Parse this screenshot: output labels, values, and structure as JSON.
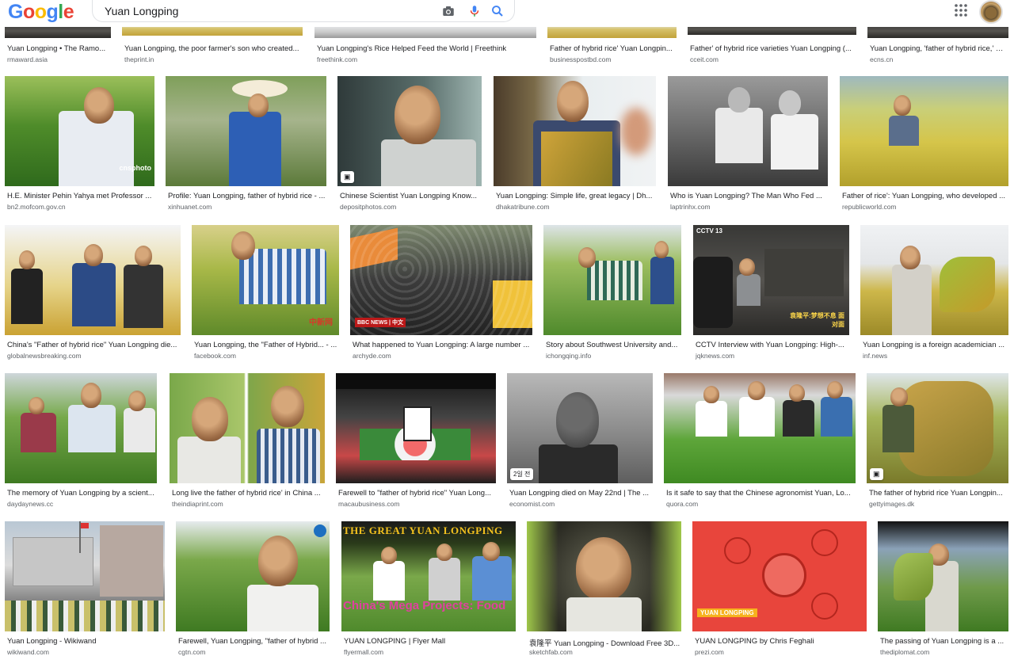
{
  "search": {
    "logo_letters": [
      "G",
      "o",
      "o",
      "g",
      "l",
      "e"
    ],
    "logo_colors": [
      "#4285F4",
      "#EA4335",
      "#FBBC05",
      "#4285F4",
      "#34A853",
      "#EA4335"
    ],
    "query": "Yuan Longping"
  },
  "colors": {
    "link_blue": "#4285F4",
    "text": "#202124",
    "source": "#5f6368"
  },
  "icons": [
    "camera-icon",
    "microphone-icon",
    "search-icon",
    "apps-grid-icon"
  ],
  "rows": [
    {
      "tiles": [
        {
          "title": "Yuan Longping • The Ramo...",
          "source": "rmaward.asia"
        },
        {
          "title": "Yuan Longping, the poor farmer's son who created...",
          "source": "theprint.in"
        },
        {
          "title": "Yuan Longping's Rice Helped Feed the World | Freethink",
          "source": "freethink.com"
        },
        {
          "title": "Father of hybrid rice' Yuan Longpin...",
          "source": "businesspostbd.com"
        },
        {
          "title": "Father' of hybrid rice varieties Yuan Longping (...",
          "source": "cceit.com"
        },
        {
          "title": "Yuan Longping, 'father of hybrid rice,' a...",
          "source": "ecns.cn"
        }
      ]
    },
    {
      "tiles": [
        {
          "title": "H.E. Minister Pehin Yahya met Professor ...",
          "source": "bn2.mofcom.gov.cn",
          "overlay": "cnsphoto"
        },
        {
          "title": "Profile: Yuan Longping, father of hybrid rice - ...",
          "source": "xinhuanet.com"
        },
        {
          "title": "Chinese Scientist Yuan Longping Know...",
          "source": "depositphotos.com"
        },
        {
          "title": "Yuan Longping: Simple life, great legacy | Dh...",
          "source": "dhakatribune.com"
        },
        {
          "title": "Who is Yuan Longping? The Man Who Fed ...",
          "source": "laptrinhx.com"
        },
        {
          "title": "Father of rice': Yuan Longping, who developed ...",
          "source": "republicworld.com"
        }
      ]
    },
    {
      "tiles": [
        {
          "title": "China's \"Father of hybrid rice\" Yuan Longping die...",
          "source": "globalnewsbreaking.com"
        },
        {
          "title": "Yuan Longping, the \"Father of Hybrid... - ...",
          "source": "facebook.com",
          "overlay": "中新网"
        },
        {
          "title": "What happened to Yuan Longping: A large number ...",
          "source": "archyde.com",
          "overlay": "BBC NEWS | 中文"
        },
        {
          "title": "Story about Southwest University and...",
          "source": "ichongqing.info"
        },
        {
          "title": "CCTV Interview with Yuan Longping: High-...",
          "source": "jqknews.com",
          "overlay": "CCTV 13",
          "overlay2": "袁隆平:梦想不息 面对面"
        },
        {
          "title": "Yuan Longping is a foreign academician ...",
          "source": "inf.news"
        }
      ]
    },
    {
      "tiles": [
        {
          "title": "The memory of Yuan Longping by a scient...",
          "source": "daydaynews.cc"
        },
        {
          "title": "Long live the father of hybrid rice' in China ...",
          "source": "theindiaprint.com"
        },
        {
          "title": "Farewell to \"father of hybrid rice\" Yuan Long...",
          "source": "macaubusiness.com"
        },
        {
          "title": "Yuan Longping died on May 22nd | The ...",
          "source": "economist.com",
          "badge": "2일 전"
        },
        {
          "title": "Is it safe to say that the Chinese agronomist Yuan, Lo...",
          "source": "quora.com"
        },
        {
          "title": "The father of hybrid rice Yuan Longpin...",
          "source": "gettyimages.dk"
        }
      ]
    },
    {
      "tiles": [
        {
          "title": "Yuan Longping - Wikiwand",
          "source": "wikiwand.com"
        },
        {
          "title": "Farewell, Yuan Longping, \"father of hybrid ...",
          "source": "cgtn.com"
        },
        {
          "title": "YUAN LONGPING | Flyer Mall",
          "source": "flyermall.com",
          "overlay": "THE GREAT YUAN LONGPING",
          "overlay2": "China's Mega Projects: Food"
        },
        {
          "title": "袁隆平 Yuan Longping - Download Free 3D...",
          "source": "sketchfab.com"
        },
        {
          "title": "YUAN LONGPING by Chris Feghali",
          "source": "prezi.com",
          "overlay": "YUAN LONGPING"
        },
        {
          "title": "The passing of Yuan Longping is a ...",
          "source": "thediplomat.com"
        }
      ]
    }
  ]
}
